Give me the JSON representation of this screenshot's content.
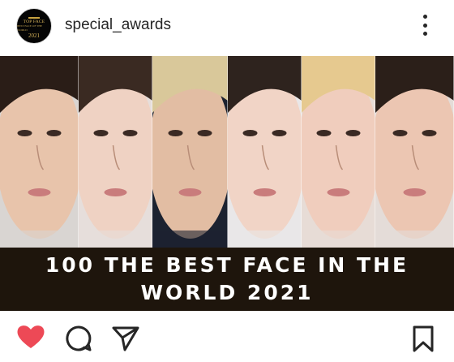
{
  "header": {
    "avatar_lines": [
      "TOP FACE",
      "BEST FACE OF THE WORLD",
      "2021"
    ],
    "username": "special_awards",
    "more_icon": "more-vertical-icon"
  },
  "post": {
    "panels": [
      {
        "name": "photo-panel-1",
        "skin": "#e8c4ab",
        "hair": "#2a1d17",
        "bg": "#d9d5d2"
      },
      {
        "name": "photo-panel-2",
        "skin": "#efd2c3",
        "hair": "#3a2a22",
        "bg": "#e6dedb"
      },
      {
        "name": "photo-panel-3",
        "skin": "#e2bda3",
        "hair": "#d9c89a",
        "bg": "#1c2230"
      },
      {
        "name": "photo-panel-4",
        "skin": "#f1d4c6",
        "hair": "#2e231e",
        "bg": "#e9e7e8"
      },
      {
        "name": "photo-panel-5",
        "skin": "#f0cdbd",
        "hair": "#e6c98f",
        "bg": "#e7dcd6"
      },
      {
        "name": "photo-panel-6",
        "skin": "#ecc6b2",
        "hair": "#2b1f19",
        "bg": "#e4dcd8"
      }
    ],
    "banner_lines": [
      "100 THE BEST FACE IN THE",
      "WORLD 2021"
    ],
    "banner_color": "#1e150c"
  },
  "actions": {
    "like_icon": "heart-filled-icon",
    "like_color": "#ed4956",
    "comment_icon": "comment-icon",
    "share_icon": "send-icon",
    "save_icon": "bookmark-icon"
  }
}
